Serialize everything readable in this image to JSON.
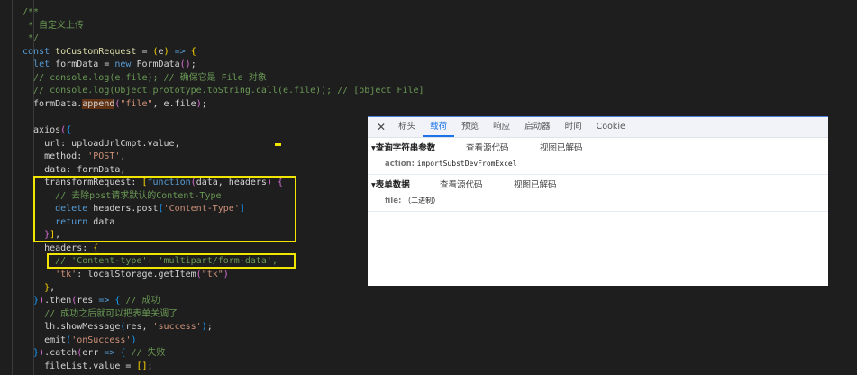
{
  "code": {
    "lines": [
      [
        [
          "cm",
          "/**"
        ]
      ],
      [
        [
          "cm",
          " * 自定义上传"
        ]
      ],
      [
        [
          "cm",
          " */"
        ]
      ],
      [
        [
          "kw",
          "const "
        ],
        [
          "fn",
          "toCustomRequest"
        ],
        [
          "tx",
          " = "
        ],
        [
          "b1",
          "("
        ],
        [
          "tx",
          "e"
        ],
        [
          "b1",
          ")"
        ],
        [
          "kw",
          " => "
        ],
        [
          "b1",
          "{"
        ]
      ],
      [
        [
          "tx",
          "  "
        ],
        [
          "kw",
          "let "
        ],
        [
          "tx",
          "formData = "
        ],
        [
          "kw",
          "new "
        ],
        [
          "tx",
          "FormData"
        ],
        [
          "b2",
          "()"
        ],
        [
          "tx",
          ";"
        ]
      ],
      [
        [
          "tx",
          "  "
        ],
        [
          "cm",
          "// console.log(e.file); // 确保它是 File 对象"
        ]
      ],
      [
        [
          "tx",
          "  "
        ],
        [
          "cm",
          "// console.log(Object.prototype.toString.call(e.file)); // [object File]"
        ]
      ],
      [
        [
          "tx",
          "  formData."
        ],
        [
          "hl",
          "append"
        ],
        [
          "b2",
          "("
        ],
        [
          "st",
          "\"file\""
        ],
        [
          "tx",
          ", e.file"
        ],
        [
          "b2",
          ")"
        ],
        [
          "tx",
          ";"
        ]
      ],
      [],
      [
        [
          "tx",
          "  axios"
        ],
        [
          "b2",
          "("
        ],
        [
          "b3",
          "{"
        ]
      ],
      [
        [
          "tx",
          "    url: uploadUrlCmpt.value,"
        ]
      ],
      [
        [
          "tx",
          "    method: "
        ],
        [
          "st",
          "'POST'"
        ],
        [
          "tx",
          ","
        ]
      ],
      [
        [
          "tx",
          "    data: formData,"
        ]
      ],
      [
        [
          "tx",
          "    transformRequest: "
        ],
        [
          "b1",
          "["
        ],
        [
          "kw",
          "function"
        ],
        [
          "b2",
          "("
        ],
        [
          "tx",
          "data, headers"
        ],
        [
          "b2",
          ")"
        ],
        [
          "tx",
          " "
        ],
        [
          "b2",
          "{"
        ]
      ],
      [
        [
          "tx",
          "      "
        ],
        [
          "cm",
          "// 去除post请求默认的Content-Type"
        ]
      ],
      [
        [
          "tx",
          "      "
        ],
        [
          "kw",
          "delete "
        ],
        [
          "tx",
          "headers.post"
        ],
        [
          "b3",
          "["
        ],
        [
          "st",
          "'Content-Type'"
        ],
        [
          "b3",
          "]"
        ]
      ],
      [
        [
          "tx",
          "      "
        ],
        [
          "kw",
          "return "
        ],
        [
          "tx",
          "data"
        ]
      ],
      [
        [
          "tx",
          "    "
        ],
        [
          "b2",
          "}"
        ],
        [
          "b1",
          "]"
        ],
        [
          "tx",
          ","
        ]
      ],
      [
        [
          "tx",
          "    headers: "
        ],
        [
          "b1",
          "{"
        ]
      ],
      [
        [
          "tx",
          "      "
        ],
        [
          "cm",
          "// 'Content-type': 'multipart/form-data',"
        ]
      ],
      [
        [
          "tx",
          "      "
        ],
        [
          "st",
          "'tk'"
        ],
        [
          "tx",
          ": localStorage.getItem"
        ],
        [
          "b2",
          "("
        ],
        [
          "st",
          "\"tk\""
        ],
        [
          "b2",
          ")"
        ]
      ],
      [
        [
          "tx",
          "    "
        ],
        [
          "b1",
          "}"
        ],
        [
          "tx",
          ","
        ]
      ],
      [
        [
          "tx",
          "  "
        ],
        [
          "b3",
          "}"
        ],
        [
          "b2",
          ")"
        ],
        [
          "tx",
          ".then"
        ],
        [
          "b2",
          "("
        ],
        [
          "tx",
          "res "
        ],
        [
          "kw",
          "=> "
        ],
        [
          "b3",
          "{"
        ],
        [
          "tx",
          " "
        ],
        [
          "cm",
          "// 成功"
        ]
      ],
      [
        [
          "tx",
          "    "
        ],
        [
          "cm",
          "// 成功之后就可以把表单关调了"
        ]
      ],
      [
        [
          "tx",
          "    lh.showMessage"
        ],
        [
          "b3",
          "("
        ],
        [
          "tx",
          "res, "
        ],
        [
          "st",
          "'success'"
        ],
        [
          "b3",
          ")"
        ],
        [
          "tx",
          ";"
        ]
      ],
      [
        [
          "tx",
          "    emit"
        ],
        [
          "b3",
          "("
        ],
        [
          "st",
          "'onSuccess'"
        ],
        [
          "b3",
          ")"
        ]
      ],
      [
        [
          "tx",
          "  "
        ],
        [
          "b3",
          "}"
        ],
        [
          "b2",
          ")"
        ],
        [
          "tx",
          ".catch"
        ],
        [
          "b2",
          "("
        ],
        [
          "tx",
          "err "
        ],
        [
          "kw",
          "=> "
        ],
        [
          "b3",
          "{"
        ],
        [
          "tx",
          " "
        ],
        [
          "cm",
          "// 失败"
        ]
      ],
      [
        [
          "tx",
          "    fileList.value = "
        ],
        [
          "b1",
          "[]"
        ],
        [
          "tx",
          ";"
        ]
      ]
    ]
  },
  "panel": {
    "close_icon": "close-icon",
    "tabs": [
      "标头",
      "载荷",
      "预览",
      "响应",
      "启动器",
      "时间",
      "Cookie"
    ],
    "active_tab": "载荷",
    "query": {
      "title": "▾查询字符串参数",
      "view_source": "查看源代码",
      "view_decoded": "视图已解码",
      "key": "action:",
      "value": "importSubstDevFromExcel"
    },
    "form": {
      "title": "▾表单数据",
      "view_source": "查看源代码",
      "view_decoded": "视图已解码",
      "key": "file:",
      "value": "（二进制）"
    }
  }
}
